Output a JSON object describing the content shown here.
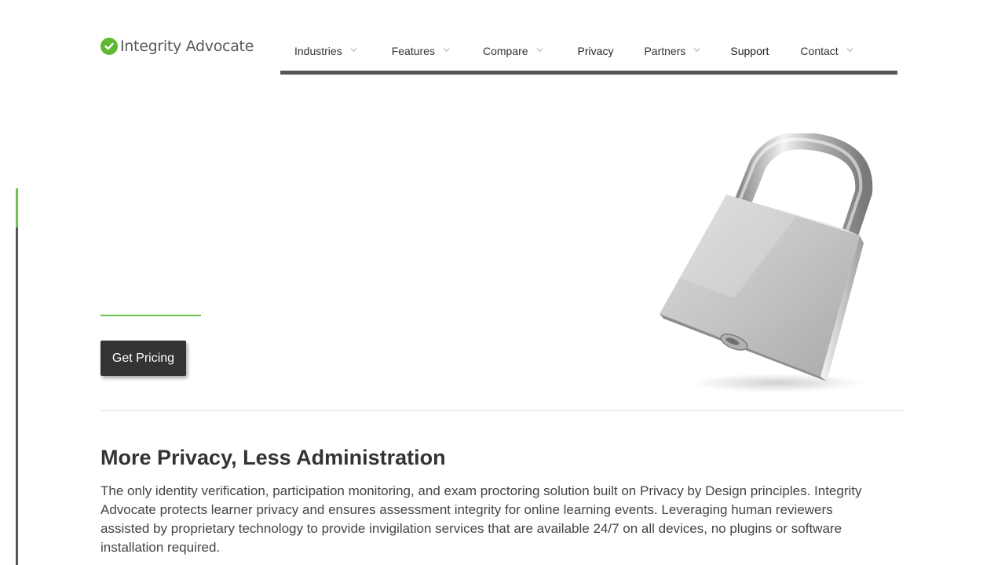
{
  "logo": {
    "text": "Integrity Advocate",
    "icon": "check-circle-icon",
    "color": "#5fb832"
  },
  "nav": {
    "items": [
      {
        "label": "Industries",
        "has_dropdown": true
      },
      {
        "label": "Features",
        "has_dropdown": true
      },
      {
        "label": "Compare",
        "has_dropdown": true
      },
      {
        "label": "Privacy",
        "has_dropdown": false
      },
      {
        "label": "Partners",
        "has_dropdown": true
      },
      {
        "label": "Support",
        "has_dropdown": false
      },
      {
        "label": "Contact",
        "has_dropdown": true
      }
    ]
  },
  "hero": {
    "cta_label": "Get Pricing",
    "image": "padlock-icon"
  },
  "section": {
    "title": "More Privacy, Less Administration",
    "body": "The only identity verification, participation monitoring, and exam proctoring solution built on Privacy by Design principles. Integrity Advocate protects learner privacy and ensures assessment integrity for online learning events. Leveraging human reviewers assisted by proprietary technology to provide invigilation services that are available 24/7 on all devices, no plugins or software installation required."
  },
  "colors": {
    "accent": "#6cc24a",
    "dark": "#333333",
    "rail": "#555555"
  }
}
